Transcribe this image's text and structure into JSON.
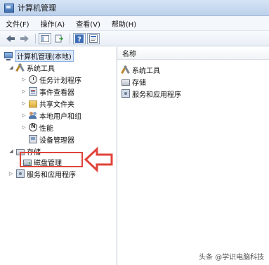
{
  "window": {
    "title": "计算机管理"
  },
  "menu": [
    "文件(F)",
    "操作(A)",
    "查看(V)",
    "帮助(H)"
  ],
  "tree": {
    "root": "计算机管理(本地)",
    "system_tools": "系统工具",
    "task_scheduler": "任务计划程序",
    "event_viewer": "事件查看器",
    "shared_folders": "共享文件夹",
    "local_users": "本地用户和组",
    "performance": "性能",
    "device_manager": "设备管理器",
    "storage": "存储",
    "disk_management": "磁盘管理",
    "services_apps": "服务和应用程序"
  },
  "right": {
    "column_header": "名称",
    "items": [
      "系统工具",
      "存储",
      "服务和应用程序"
    ]
  },
  "watermark": "头条 @学识电脑科技",
  "colors": {
    "annotation": "#e0443a",
    "selection": "#dde9f8"
  }
}
